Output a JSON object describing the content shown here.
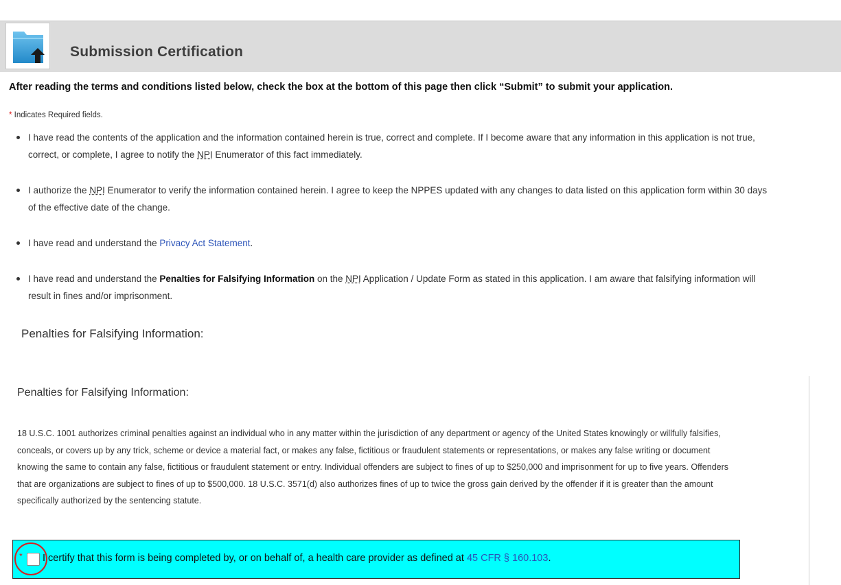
{
  "header": {
    "icon": "folder-upload-icon",
    "title": "Submission Certification"
  },
  "instructions": "After reading the terms and conditions listed below, check the box at the bottom of this page then click “Submit” to submit your application.",
  "required_note": {
    "star": "*",
    "text": " Indicates Required fields."
  },
  "terms": [
    {
      "a": "I have read the contents of the application and the information contained herein is true, correct and complete. If I become aware that any information in this application is not true, correct, or complete, I agree to notify the ",
      "abbr": "NPI",
      "b": " Enumerator of this fact immediately."
    },
    {
      "a": "I authorize the ",
      "abbr": "NPI",
      "b": " Enumerator to verify the information contained herein. I agree to keep the NPPES updated with any changes to data listed on this application form within 30 days of the effective date of the change."
    },
    {
      "a": "I have read and understand the ",
      "link": "Privacy Act Statement",
      "b": "."
    },
    {
      "a": "I have read and understand the ",
      "strong": "Penalties for Falsifying Information",
      "b": " on the ",
      "abbr": "NPI",
      "c": " Application / Update Form as stated in this application. I am aware that falsifying information will result in fines and/or imprisonment."
    }
  ],
  "section_heading": "Penalties for Falsifying Information:",
  "penalties": {
    "heading": "Penalties for Falsifying Information:",
    "text": "18 U.S.C. 1001 authorizes criminal penalties against an individual who in any matter within the jurisdiction of any department or agency of the United States knowingly or willfully falsifies, conceals, or covers up by any trick, scheme or device a material fact, or makes any false, fictitious or fraudulent statements or representations, or makes any false writing or document knowing the same to contain any false, fictitious or fraudulent statement or entry. Individual offenders are subject to fines of up to $250,000 and imprisonment for up to five years. Offenders that are organizations are subject to fines of up to $500,000. 18 U.S.C. 3571(d) also authorizes fines of up to twice the gross gain derived by the offender if it is greater than the amount specifically authorized by the sentencing statute."
  },
  "certification": {
    "star": "*",
    "checked": false,
    "text": "I certify that this form is being completed by, or on behalf of, a health care provider as defined at ",
    "link": "45 CFR § 160.103",
    "end": ".",
    "highlight_color": "#00ffff",
    "annotation_color": "#d62020"
  }
}
